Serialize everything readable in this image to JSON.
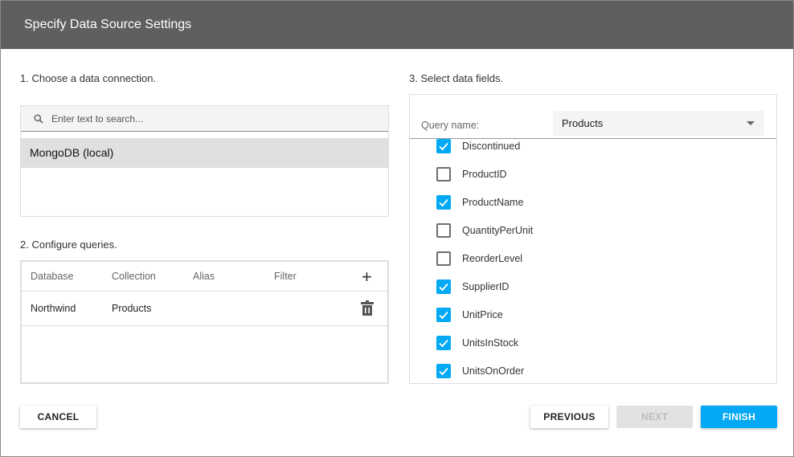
{
  "title": "Specify Data Source Settings",
  "step1": {
    "label": "1. Choose a data connection.",
    "search_placeholder": "Enter text to search...",
    "connections": [
      "MongoDB (local)"
    ]
  },
  "step2": {
    "label": "2. Configure queries.",
    "columns": [
      "Database",
      "Collection",
      "Alias",
      "Filter"
    ],
    "rows": [
      {
        "database": "Northwind",
        "collection": "Products",
        "alias": "",
        "filter": ""
      }
    ]
  },
  "step3": {
    "label": "3. Select data fields.",
    "query_label": "Query name:",
    "query_value": "Products",
    "fields": [
      {
        "name": "Discontinued",
        "checked": true
      },
      {
        "name": "ProductID",
        "checked": false
      },
      {
        "name": "ProductName",
        "checked": true
      },
      {
        "name": "QuantityPerUnit",
        "checked": false
      },
      {
        "name": "ReorderLevel",
        "checked": false
      },
      {
        "name": "SupplierID",
        "checked": true
      },
      {
        "name": "UnitPrice",
        "checked": true
      },
      {
        "name": "UnitsInStock",
        "checked": true
      },
      {
        "name": "UnitsOnOrder",
        "checked": true
      }
    ]
  },
  "buttons": {
    "cancel": "CANCEL",
    "previous": "PREVIOUS",
    "next": "NEXT",
    "finish": "FINISH"
  },
  "colors": {
    "accent": "#03a9f4",
    "header": "#5f5f5f"
  }
}
